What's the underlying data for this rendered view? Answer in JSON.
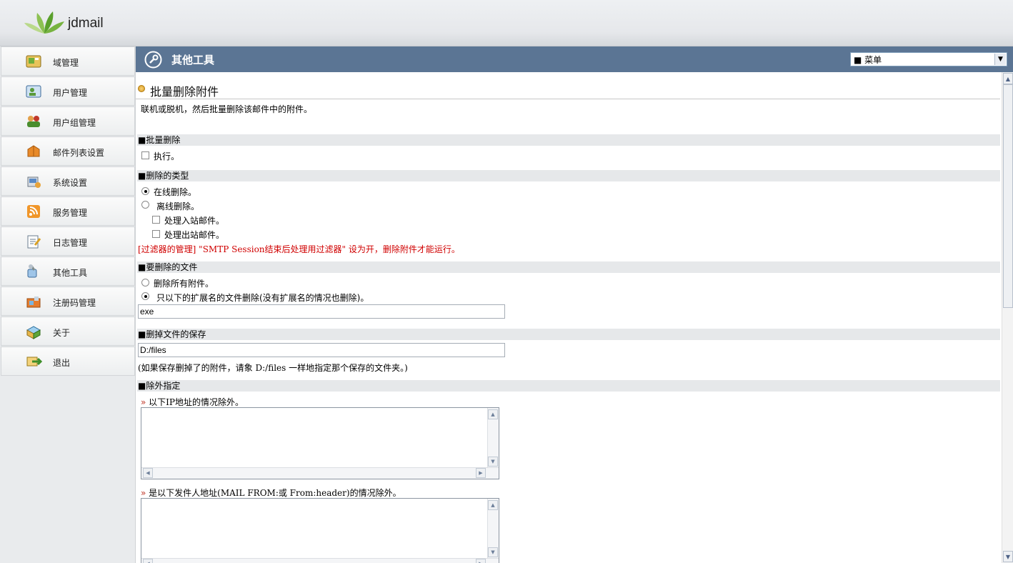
{
  "app": {
    "brand": "jdmail",
    "logo_icon": "leaf-logo-icon"
  },
  "sidebar": {
    "items": [
      {
        "label": "域管理",
        "icon": "domain-icon"
      },
      {
        "label": "用户管理",
        "icon": "user-icon"
      },
      {
        "label": "用户组管理",
        "icon": "user-group-icon"
      },
      {
        "label": "邮件列表设置",
        "icon": "mail-list-icon"
      },
      {
        "label": "系统设置",
        "icon": "system-icon"
      },
      {
        "label": "服务管理",
        "icon": "rss-icon"
      },
      {
        "label": "日志管理",
        "icon": "log-icon"
      },
      {
        "label": "其他工具",
        "icon": "tools-icon"
      },
      {
        "label": "注册码管理",
        "icon": "license-icon"
      },
      {
        "label": "关于",
        "icon": "about-icon"
      },
      {
        "label": "退出",
        "icon": "exit-icon"
      }
    ]
  },
  "titlebar": {
    "title": "其他工具",
    "menu_value": "■ 菜单"
  },
  "page": {
    "heading": "批量删除附件",
    "description": "联机或脱机，然后批量删除该邮件中的附件。",
    "sections": {
      "batch": {
        "title": "■批量删除",
        "execute_label": "执行。",
        "execute_checked": false
      },
      "type": {
        "title": "■删除的类型",
        "online_label": "在线删除。",
        "offline_label": "离线删除。",
        "selected": "online",
        "inbound_label": "处理入站邮件。",
        "outbound_label": "处理出站邮件。",
        "warning": "[过滤器的管理] \"SMTP Session结束后处理用过滤器\" 设为开，删除附件才能运行。"
      },
      "files": {
        "title": "■要删除的文件",
        "all_label": "删除所有附件。",
        "ext_label": "只以下的扩展名的文件删除(没有扩展名的情况也删除)。",
        "selected": "ext",
        "ext_value": "exe"
      },
      "save": {
        "title": "■删掉文件的保存",
        "path_value": "D:/files",
        "note": "(如果保存删掉了的附件，请象  D:/files 一样地指定那个保存的文件夹。)"
      },
      "exclude": {
        "title": "■除外指定",
        "ip_label": "以下IP地址的情况除外。",
        "sender_label": "是以下发件人地址(MAIL FROM:或  From:header)的情况除外。",
        "mark": "»"
      }
    }
  },
  "colors": {
    "titlebar": "#5b7594",
    "warning": "#d00000",
    "section_bg": "#e6e8ea"
  }
}
